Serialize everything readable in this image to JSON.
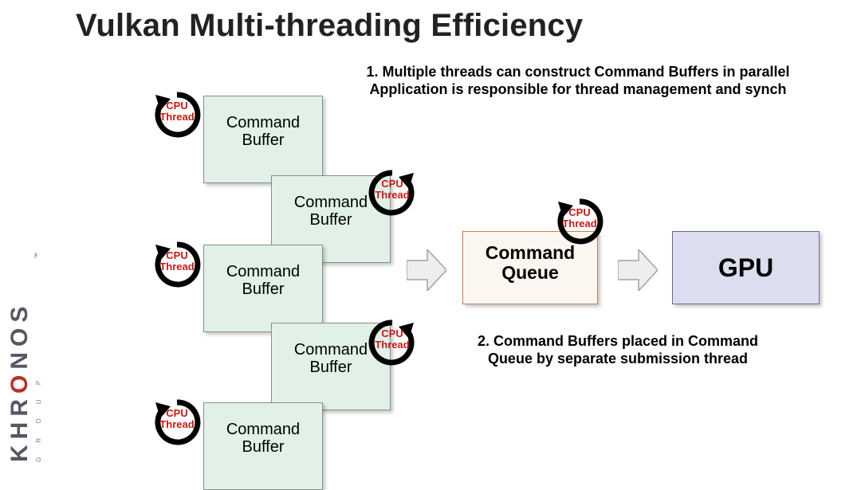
{
  "title": "Vulkan Multi-threading Efficiency",
  "annot1_line1": "1. Multiple threads can construct Command Buffers in parallel",
  "annot1_line2": "Application is responsible for thread management and synch",
  "annot2_line1": "2. Command Buffers placed in Command",
  "annot2_line2": "Queue by separate submission thread",
  "buffer_label_l1": "Command",
  "buffer_label_l2": "Buffer",
  "queue_label_l1": "Command",
  "queue_label_l2": "Queue",
  "gpu_label": "GPU",
  "cpu_label_l1": "CPU",
  "cpu_label_l2": "Thread",
  "logo_text_prefix": "KHR",
  "logo_text_o": "O",
  "logo_text_suffix": "NOS",
  "logo_sub": "G   R   O   U   P",
  "logo_tm": "™"
}
